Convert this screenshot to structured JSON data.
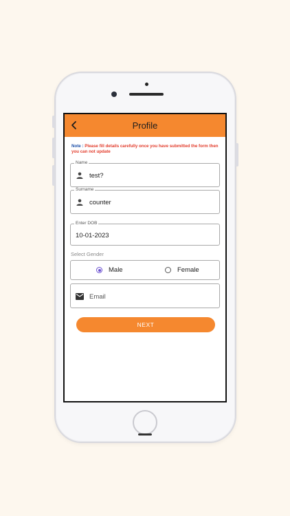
{
  "header": {
    "title": "Profile"
  },
  "note": {
    "label": "Note :",
    "text": "Please fill details carefully once you have submitted the form then you can not update"
  },
  "form": {
    "name": {
      "label": "Name",
      "value": "test?"
    },
    "surname": {
      "label": "Surname",
      "value": "counter"
    },
    "dob": {
      "label": "Enter DOB",
      "value": "10-01-2023"
    },
    "gender": {
      "label": "Select Gender",
      "options": [
        "Male",
        "Female"
      ],
      "selected": "Male"
    },
    "email": {
      "placeholder": "Email"
    }
  },
  "actions": {
    "next_label": "NEXT"
  },
  "colors": {
    "accent": "#f5882f",
    "radio": "#6a4fd0",
    "note_label": "#1c4fa8",
    "note_text": "#e23b2a"
  },
  "icons": {
    "back": "chevron-left-icon",
    "person": "person-icon",
    "email": "mail-icon"
  }
}
